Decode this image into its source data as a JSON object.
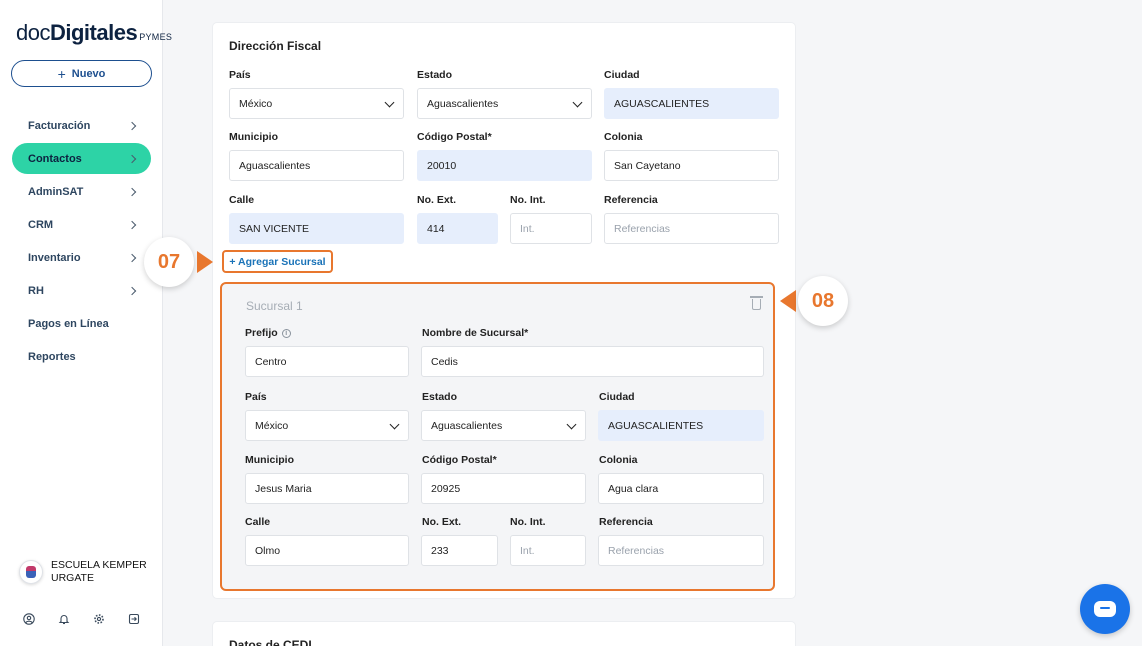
{
  "logo": {
    "doc": "doc",
    "digitales": "Digitales",
    "pymes": "PYMES"
  },
  "new_button": {
    "label": "Nuevo"
  },
  "nav": [
    {
      "label": "Facturación",
      "has_chevron": true,
      "active": false
    },
    {
      "label": "Contactos",
      "has_chevron": true,
      "active": true
    },
    {
      "label": "AdminSAT",
      "has_chevron": true,
      "active": false
    },
    {
      "label": "CRM",
      "has_chevron": true,
      "active": false
    },
    {
      "label": "Inventario",
      "has_chevron": true,
      "active": false
    },
    {
      "label": "RH",
      "has_chevron": true,
      "active": false
    },
    {
      "label": "Pagos en Línea",
      "has_chevron": false,
      "active": false
    },
    {
      "label": "Reportes",
      "has_chevron": false,
      "active": false
    }
  ],
  "user": {
    "name": "ESCUELA KEMPER URGATE"
  },
  "bottom_icons": [
    "user-circle-icon",
    "bell-icon",
    "gear-icon",
    "logout-icon"
  ],
  "fiscal": {
    "title": "Dirección Fiscal",
    "labels": {
      "pais": "País",
      "estado": "Estado",
      "ciudad": "Ciudad",
      "municipio": "Municipio",
      "cp": "Código Postal*",
      "colonia": "Colonia",
      "calle": "Calle",
      "ext": "No. Ext.",
      "int": "No. Int.",
      "referencia": "Referencia"
    },
    "values": {
      "pais": "México",
      "estado": "Aguascalientes",
      "ciudad": "AGUASCALIENTES",
      "municipio": "Aguascalientes",
      "cp": "20010",
      "colonia": "San Cayetano",
      "calle": "SAN VICENTE",
      "ext": "414"
    },
    "placeholders": {
      "int": "Int.",
      "referencia": "Referencias"
    }
  },
  "add_branch": {
    "label": "+ Agregar Sucursal"
  },
  "branch": {
    "title": "Sucursal 1",
    "labels": {
      "prefijo": "Prefijo",
      "nombre": "Nombre de Sucursal*",
      "pais": "País",
      "estado": "Estado",
      "ciudad": "Ciudad",
      "municipio": "Municipio",
      "cp": "Código Postal*",
      "colonia": "Colonia",
      "calle": "Calle",
      "ext": "No. Ext.",
      "int": "No. Int.",
      "referencia": "Referencia"
    },
    "values": {
      "prefijo": "Centro",
      "nombre": "Cedis",
      "pais": "México",
      "estado": "Aguascalientes",
      "ciudad": "AGUASCALIENTES",
      "municipio": "Jesus Maria",
      "cp": "20925",
      "colonia": "Agua clara",
      "calle": "Olmo",
      "ext": "233"
    },
    "placeholders": {
      "int": "Int.",
      "referencia": "Referencias"
    }
  },
  "callouts": {
    "step_07": "07",
    "step_08": "08"
  },
  "next_section": {
    "title": "Datos de CEDI"
  },
  "colors": {
    "accent_green": "#2dd3a6",
    "callout_orange": "#e8772e",
    "link_blue": "#1a73b8",
    "highlight": "#e6eefc"
  }
}
